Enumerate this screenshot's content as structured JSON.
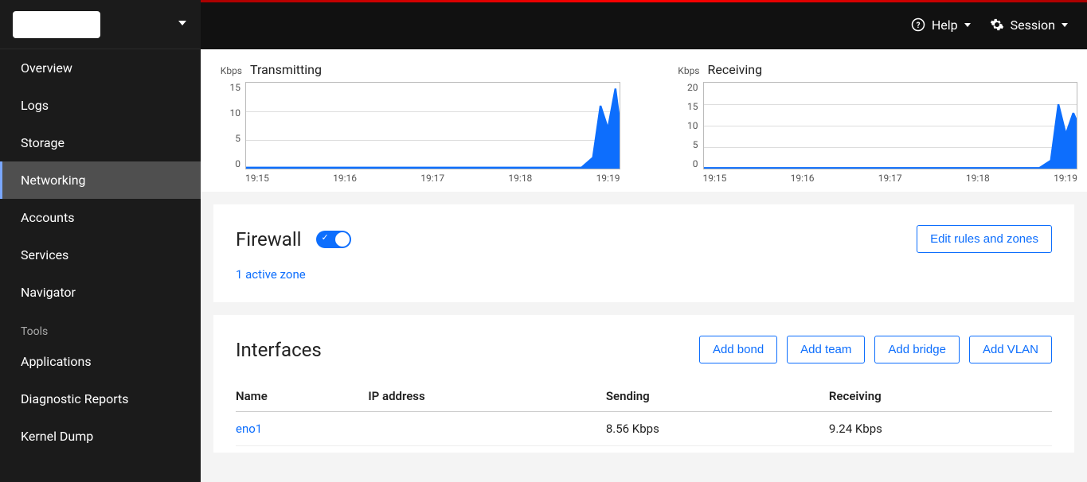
{
  "topbar": {
    "help_label": "Help",
    "session_label": "Session"
  },
  "sidebar": {
    "items": [
      {
        "label": "Overview",
        "active": false
      },
      {
        "label": "Logs",
        "active": false
      },
      {
        "label": "Storage",
        "active": false
      },
      {
        "label": "Networking",
        "active": true
      },
      {
        "label": "Accounts",
        "active": false
      },
      {
        "label": "Services",
        "active": false
      },
      {
        "label": "Navigator",
        "active": false
      }
    ],
    "tools_label": "Tools",
    "tools": [
      {
        "label": "Applications"
      },
      {
        "label": "Diagnostic Reports"
      },
      {
        "label": "Kernel Dump"
      }
    ]
  },
  "chart_data": [
    {
      "type": "area",
      "title": "Transmitting",
      "unit": "Kbps",
      "y_ticks": [
        15,
        10,
        5,
        0
      ],
      "ylim": [
        0,
        15
      ],
      "x_ticks": [
        "19:15",
        "19:16",
        "19:17",
        "19:18",
        "19:19"
      ],
      "series": [
        {
          "name": "tx",
          "color": "#0d6efd",
          "x": [
            0,
            0.05,
            0.1,
            0.15,
            0.2,
            0.25,
            0.3,
            0.35,
            0.4,
            0.45,
            0.5,
            0.55,
            0.6,
            0.65,
            0.7,
            0.75,
            0.8,
            0.85,
            0.88,
            0.9,
            0.93,
            0.95,
            0.97,
            0.99,
            1.0
          ],
          "values": [
            0.3,
            0.3,
            0.3,
            0.3,
            0.3,
            0.3,
            0.3,
            0.3,
            0.3,
            0.3,
            0.3,
            0.3,
            0.3,
            0.3,
            0.3,
            0.3,
            0.3,
            0.3,
            0.3,
            0.3,
            2,
            11,
            7,
            14,
            9
          ]
        }
      ]
    },
    {
      "type": "area",
      "title": "Receiving",
      "unit": "Kbps",
      "y_ticks": [
        20,
        15,
        10,
        5,
        0
      ],
      "ylim": [
        0,
        20
      ],
      "x_ticks": [
        "19:15",
        "19:16",
        "19:17",
        "19:18",
        "19:19"
      ],
      "series": [
        {
          "name": "rx",
          "color": "#0d6efd",
          "x": [
            0,
            0.05,
            0.1,
            0.15,
            0.2,
            0.25,
            0.3,
            0.35,
            0.4,
            0.45,
            0.5,
            0.55,
            0.6,
            0.65,
            0.7,
            0.75,
            0.8,
            0.85,
            0.88,
            0.9,
            0.93,
            0.95,
            0.97,
            0.99,
            1.0
          ],
          "values": [
            0.3,
            0.3,
            0.3,
            0.3,
            0.3,
            0.3,
            0.3,
            0.3,
            0.3,
            0.3,
            0.3,
            0.3,
            0.3,
            0.3,
            0.3,
            0.3,
            0.3,
            0.3,
            0.3,
            0.3,
            2,
            15,
            8,
            13,
            11
          ]
        }
      ]
    }
  ],
  "firewall": {
    "title": "Firewall",
    "enabled": true,
    "active_zone_text": "1 active zone",
    "edit_button": "Edit rules and zones"
  },
  "interfaces": {
    "title": "Interfaces",
    "buttons": [
      "Add bond",
      "Add team",
      "Add bridge",
      "Add VLAN"
    ],
    "columns": [
      "Name",
      "IP address",
      "Sending",
      "Receiving"
    ],
    "rows": [
      {
        "name": "eno1",
        "ip": "",
        "sending": "8.56 Kbps",
        "receiving": "9.24 Kbps"
      }
    ]
  }
}
